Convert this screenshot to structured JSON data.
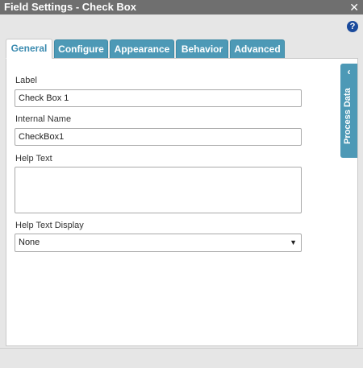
{
  "window": {
    "title": "Field Settings - Check Box",
    "close_icon": "close-icon"
  },
  "toolbar": {
    "help_icon": "question-circle-icon",
    "help_glyph": "?"
  },
  "tabs": [
    {
      "label": "General",
      "active": true
    },
    {
      "label": "Configure",
      "active": false
    },
    {
      "label": "Appearance",
      "active": false
    },
    {
      "label": "Behavior",
      "active": false
    },
    {
      "label": "Advanced",
      "active": false
    }
  ],
  "side_panel": {
    "label": "Process Data",
    "icon": "chevron-left-icon"
  },
  "form": {
    "label": {
      "caption": "Label",
      "value": "Check Box 1"
    },
    "internal_name": {
      "caption": "Internal Name",
      "value": "CheckBox1"
    },
    "help_text": {
      "caption": "Help Text",
      "value": ""
    },
    "help_text_display": {
      "caption": "Help Text Display",
      "selected": "None"
    }
  },
  "colors": {
    "accent": "#4d99b6",
    "title_bar": "#6f6f6f",
    "active_tab_text": "#3b8bb0"
  }
}
